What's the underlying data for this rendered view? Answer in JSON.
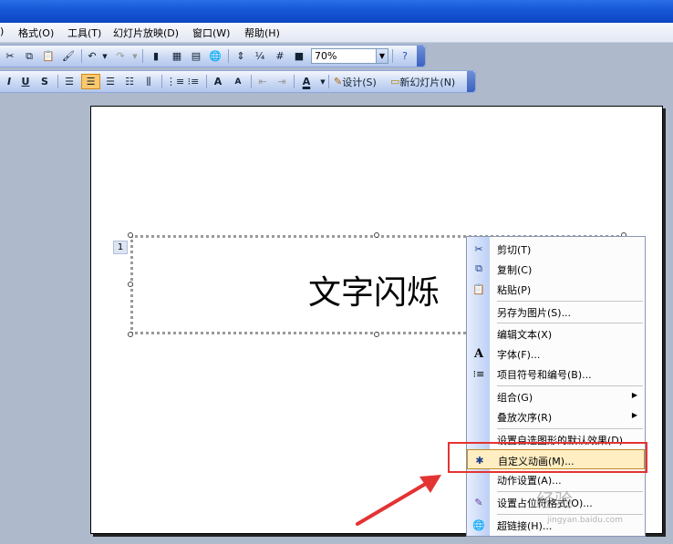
{
  "menu": [
    "格式(O)",
    "工具(T)",
    "幻灯片放映(D)",
    "窗口(W)",
    "帮助(H)"
  ],
  "toolbar": {
    "zoom": "70%",
    "design_label": "设计(S)",
    "new_slide_label": "新幻灯片(N)"
  },
  "format": {
    "italic": "I",
    "underline": "U",
    "shadow": "S",
    "grow": "A",
    "shrink": "A",
    "font_color": "A"
  },
  "slide": {
    "number": "1",
    "text": "文字闪烁"
  },
  "context_menu": {
    "items": [
      {
        "label": "剪切(T)",
        "icon": "scissors-icon"
      },
      {
        "label": "复制(C)",
        "icon": "copy-icon"
      },
      {
        "label": "粘贴(P)",
        "icon": "paste-icon"
      },
      {
        "label": "另存为图片(S)...",
        "icon": ""
      },
      {
        "label": "编辑文本(X)",
        "icon": ""
      },
      {
        "label": "字体(F)...",
        "icon": "font-icon"
      },
      {
        "label": "项目符号和编号(B)...",
        "icon": "bullets-icon"
      },
      {
        "label": "组合(G)",
        "icon": "",
        "submenu": true
      },
      {
        "label": "叠放次序(R)",
        "icon": "",
        "submenu": true
      },
      {
        "label": "设置自选图形的默认效果(D)",
        "icon": ""
      },
      {
        "label": "自定义动画(M)...",
        "icon": "custom-animation-icon",
        "highlighted": true
      },
      {
        "label": "动作设置(A)...",
        "icon": ""
      },
      {
        "label": "设置占位符格式(O)...",
        "icon": "format-icon"
      },
      {
        "label": "超链接(H)...",
        "icon": "hyperlink-icon"
      }
    ]
  },
  "watermark": {
    "main": "经验",
    "sub": "jingyan.baidu.com"
  },
  "colors": {
    "highlight": "#ffeec2",
    "annotation": "#e43333",
    "accent": "#1556d6"
  }
}
